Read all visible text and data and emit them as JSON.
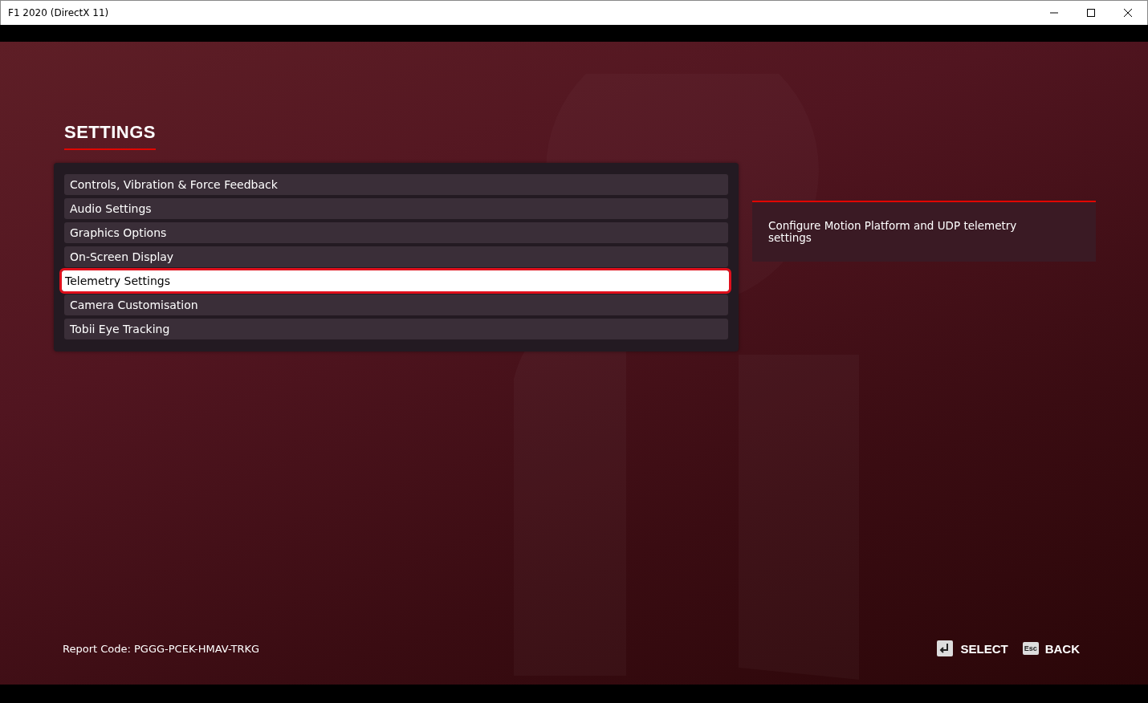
{
  "window": {
    "title": "F1 2020 (DirectX 11)"
  },
  "heading": "SETTINGS",
  "menu": [
    {
      "label": "Controls, Vibration & Force Feedback",
      "selected": false
    },
    {
      "label": "Audio Settings",
      "selected": false
    },
    {
      "label": "Graphics Options",
      "selected": false
    },
    {
      "label": "On-Screen Display",
      "selected": false
    },
    {
      "label": "Telemetry Settings",
      "selected": true
    },
    {
      "label": "Camera Customisation",
      "selected": false
    },
    {
      "label": "Tobii Eye Tracking",
      "selected": false
    }
  ],
  "description": "Configure Motion Platform and UDP telemetry settings",
  "report_code": "Report Code: PGGG-PCEK-HMAV-TRKG",
  "actions": [
    {
      "kind": "enter",
      "label": "SELECT"
    },
    {
      "kind": "esc",
      "key": "Esc",
      "label": "BACK"
    }
  ]
}
